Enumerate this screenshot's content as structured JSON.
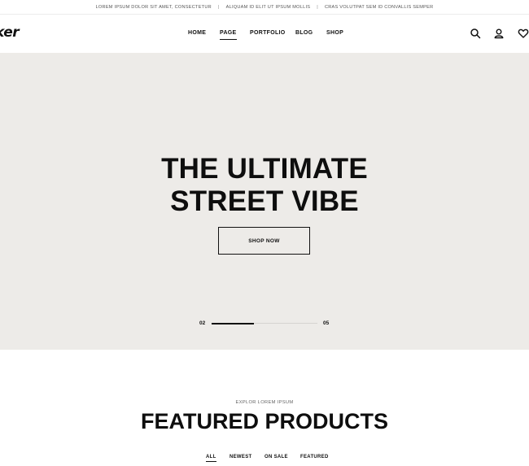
{
  "topbar": {
    "messages": [
      "LOREM IPSUM DOLOR SIT AMET, CONSECTETUR",
      "ALIQUAM ID ELIT UT IPSUM MOLLIS",
      "CRAS VOLUTPAT SEM ID CONVALLIS SEMPER"
    ],
    "separator": "|"
  },
  "header": {
    "logo_text": "ker",
    "nav": [
      "HOME",
      "PAGE",
      "PORTFOLIO",
      "BLOG",
      "SHOP"
    ],
    "active_nav": "PAGE",
    "icons": [
      "search-icon",
      "user-icon",
      "heart-icon"
    ]
  },
  "hero": {
    "title_line1": "THE ULTIMATE",
    "title_line2": "STREET VIBE",
    "button_label": "SHOP NOW",
    "slide_current": "02",
    "slide_total": "05",
    "progress": 0.4,
    "background": "#edebe8"
  },
  "featured": {
    "kicker": "EXPLOR LOREM IPSUM",
    "title": "FEATURED PRODUCTS",
    "filters": [
      "ALL",
      "NEWEST",
      "ON SALE",
      "FEATURED"
    ],
    "active_filter": "ALL"
  }
}
